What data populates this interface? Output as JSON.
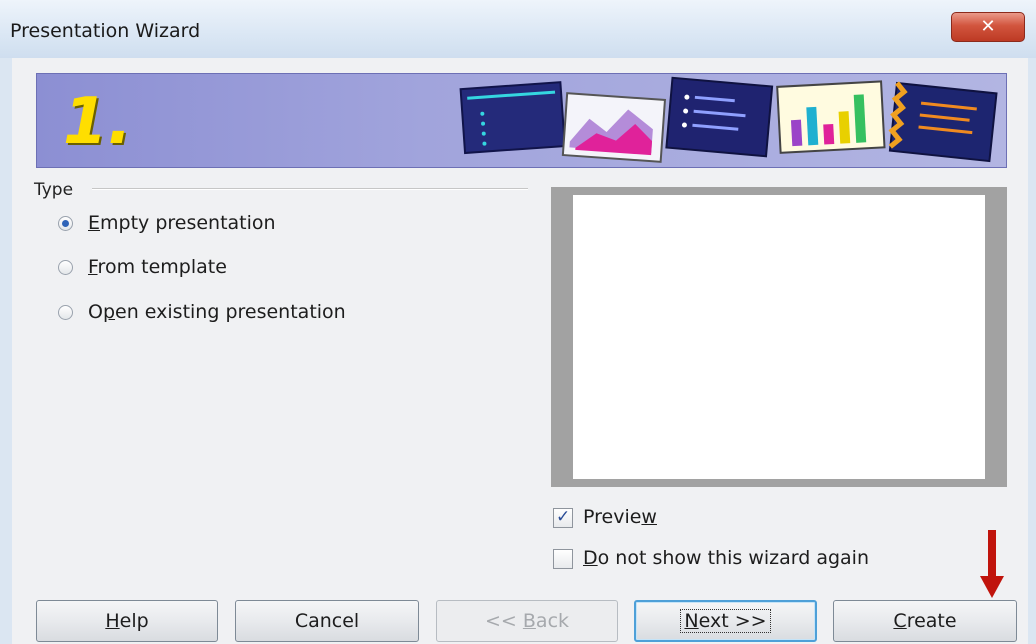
{
  "window": {
    "title": "Presentation Wizard",
    "close_label": "✕"
  },
  "banner": {
    "step": "1."
  },
  "type_section": {
    "label": "Type",
    "options": [
      {
        "prefix": "",
        "key": "E",
        "rest": "mpty presentation",
        "checked": true
      },
      {
        "prefix": "",
        "key": "F",
        "rest": "rom template",
        "checked": false
      },
      {
        "prefix": "O",
        "key": "p",
        "rest": "en existing presentation",
        "checked": false
      }
    ]
  },
  "preview": {
    "prefix": "Previe",
    "key": "w",
    "checked": true
  },
  "dont_show": {
    "prefix": "",
    "key": "D",
    "rest": "o not show this wizard again",
    "checked": false
  },
  "buttons": {
    "help": {
      "key": "H",
      "rest": "elp"
    },
    "cancel": {
      "label": "Cancel"
    },
    "back": {
      "prefix": "<< ",
      "key": "B",
      "rest": "ack"
    },
    "next": {
      "key": "N",
      "rest": "ext >>"
    },
    "create": {
      "key": "C",
      "rest": "reate"
    }
  },
  "colors": {
    "banner": "#a1a4dc",
    "step_number": "#ffde00",
    "arrow": "#c0140c",
    "default_button_border": "#4ea0d8"
  }
}
